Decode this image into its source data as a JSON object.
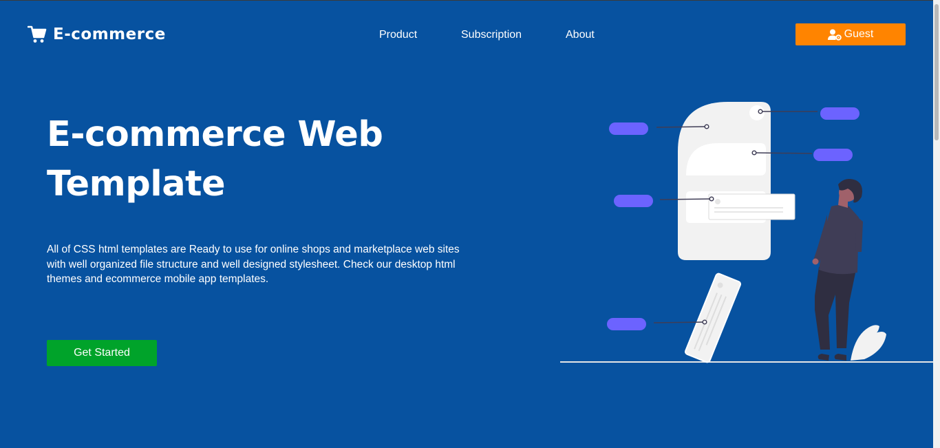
{
  "header": {
    "brand_name": "E-commerce",
    "brand_icon": "shopping-cart-icon",
    "nav": [
      {
        "label": "Product"
      },
      {
        "label": "Subscription"
      },
      {
        "label": "About"
      }
    ],
    "guest_button": {
      "label": "Guest",
      "icon": "user-cog-icon",
      "color": "#ff8400"
    }
  },
  "hero": {
    "title": "E-commerce Web Template",
    "description": "All of CSS html templates are Ready to use for online shops and marketplace web sites with well organized file structure and well designed stylesheet. Check our desktop html themes and ecommerce mobile app templates.",
    "cta_label": "Get Started",
    "cta_color": "#00a32a"
  },
  "theme": {
    "background": "#0752a0",
    "accent_pill": "#6c63ff"
  }
}
